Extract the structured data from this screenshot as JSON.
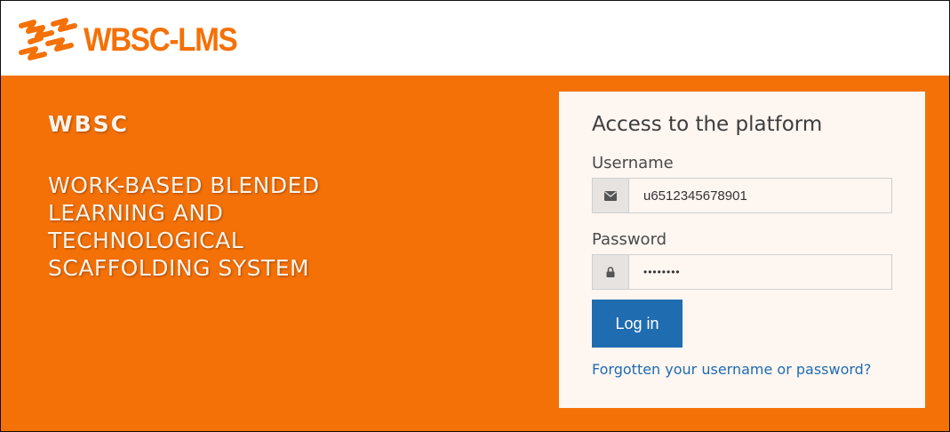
{
  "brand": {
    "logo_text": "WBSC-LMS",
    "primary_color": "#f47107",
    "accent_color": "#1f6cb0",
    "logo_icon": "wbsc-logo-icon"
  },
  "hero": {
    "title": "WBSC",
    "subtitle": "WORK-BASED BLENDED LEARNING AND TECHNOLOGICAL SCAFFOLDING SYSTEM"
  },
  "login": {
    "heading": "Access to the platform",
    "username_label": "Username",
    "username_value": "u6512345678901",
    "username_icon": "envelope-icon",
    "password_label": "Password",
    "password_value": "••••••••",
    "password_icon": "lock-icon",
    "submit_label": "Log in",
    "forgot_link": "Forgotten your username or password?"
  }
}
